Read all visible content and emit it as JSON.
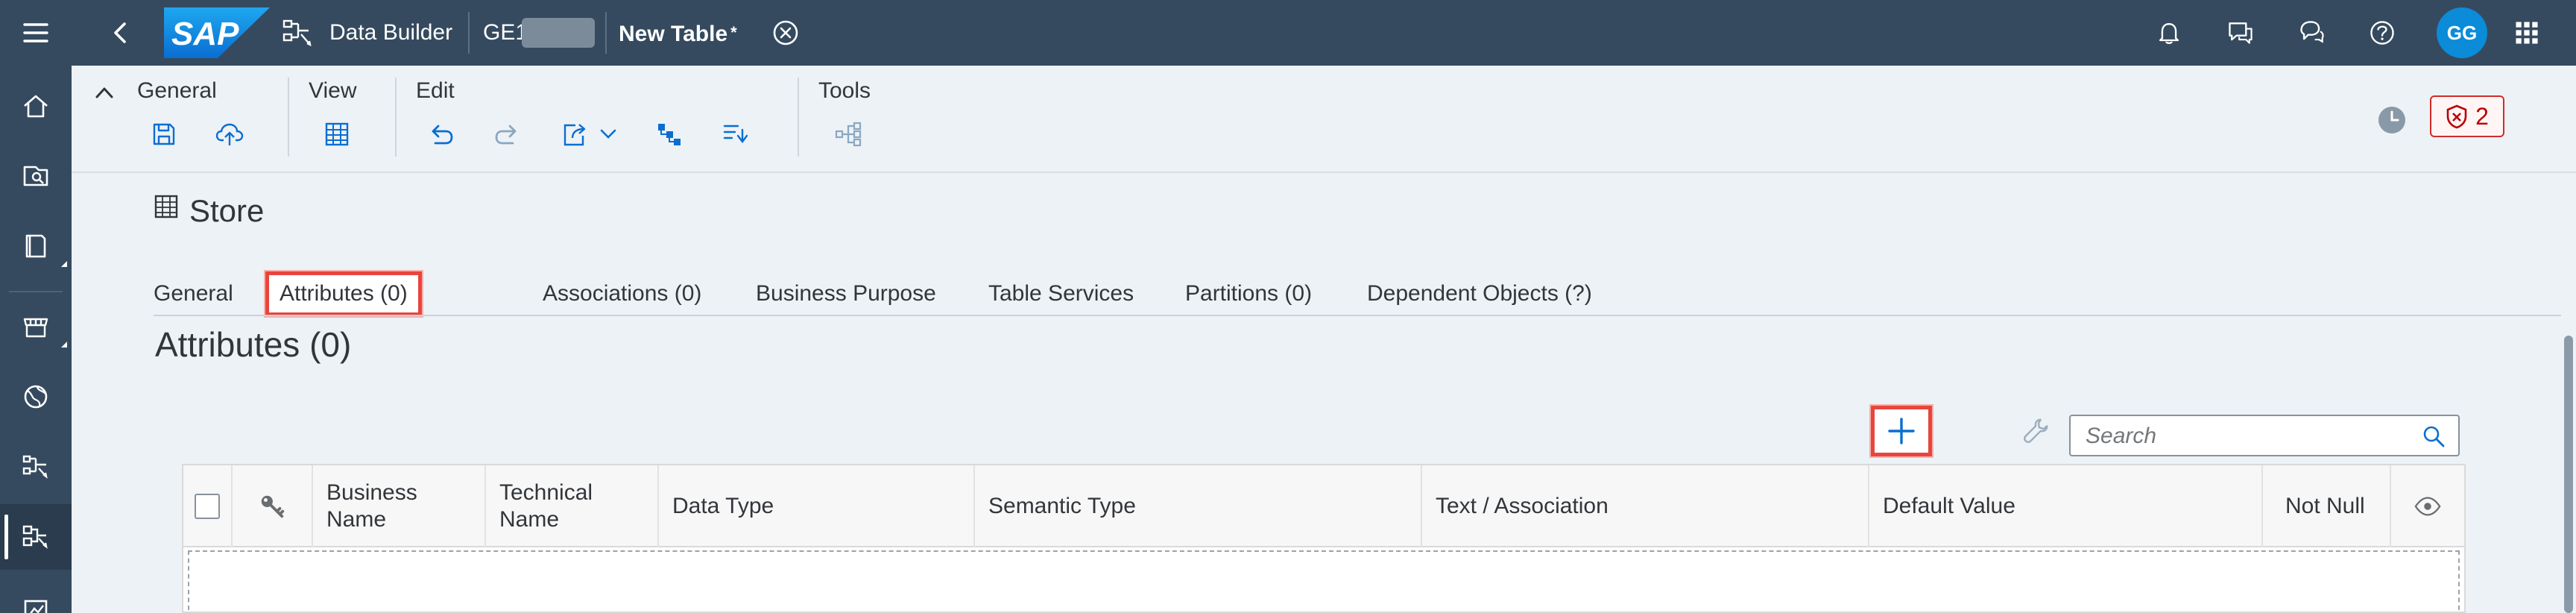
{
  "shell": {
    "app_title": "Data Builder",
    "space_prefix": "GE1",
    "doc_title": "New Table",
    "doc_dirty_marker": "*",
    "avatar_initials": "GG",
    "brand_color": "#354a5f"
  },
  "rail": {
    "items": [
      "home-icon",
      "data-search-icon",
      "catalog-icon",
      "marketplace-icon",
      "globe-icon",
      "data-builder-icon",
      "data-builder-active-icon",
      "monitor-icon"
    ]
  },
  "toolbar": {
    "groups": {
      "general": "General",
      "view": "View",
      "edit": "Edit",
      "tools": "Tools"
    },
    "issues_count": "2"
  },
  "editor": {
    "object_title": "Store",
    "tabs": [
      {
        "label": "General"
      },
      {
        "label": "Attributes (0)"
      },
      {
        "label": "Associations (0)"
      },
      {
        "label": "Business Purpose"
      },
      {
        "label": "Table Services"
      },
      {
        "label": "Partitions (0)"
      },
      {
        "label": "Dependent Objects (?)"
      }
    ],
    "selected_tab": "Attributes (0)",
    "section_title": "Attributes (0)",
    "search_placeholder": "Search",
    "table": {
      "columns": [
        {
          "label": ""
        },
        {
          "label": ""
        },
        {
          "label": "Business\nName"
        },
        {
          "label": "Technical\nName"
        },
        {
          "label": "Data Type"
        },
        {
          "label": "Semantic Type"
        },
        {
          "label": "Text / Association"
        },
        {
          "label": "Default Value"
        },
        {
          "label": "Not Null"
        },
        {
          "label": ""
        }
      ],
      "rows": []
    },
    "highlight_color": "#e8453c"
  }
}
